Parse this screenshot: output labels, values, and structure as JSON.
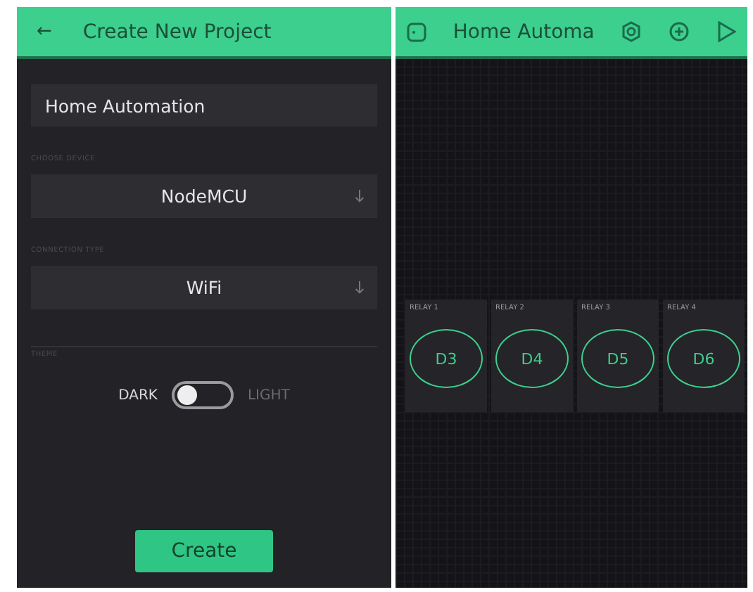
{
  "create_panel": {
    "header": {
      "back": "←",
      "title": "Create New Project"
    },
    "project_name": {
      "value": "Home Automation"
    },
    "device": {
      "label": "CHOOSE DEVICE",
      "value": "NodeMCU"
    },
    "connection": {
      "label": "CONNECTION TYPE",
      "value": "WiFi"
    },
    "theme": {
      "label": "THEME",
      "left_label": "DARK",
      "right_label": "LIGHT",
      "on": false
    },
    "create_button": "Create"
  },
  "project_panel": {
    "header": {
      "title": "Home Automa"
    },
    "widgets": [
      {
        "label": "RELAY 1",
        "pin": "D3"
      },
      {
        "label": "RELAY 2",
        "pin": "D4"
      },
      {
        "label": "RELAY 3",
        "pin": "D5"
      },
      {
        "label": "RELAY 4",
        "pin": "D6"
      }
    ]
  }
}
